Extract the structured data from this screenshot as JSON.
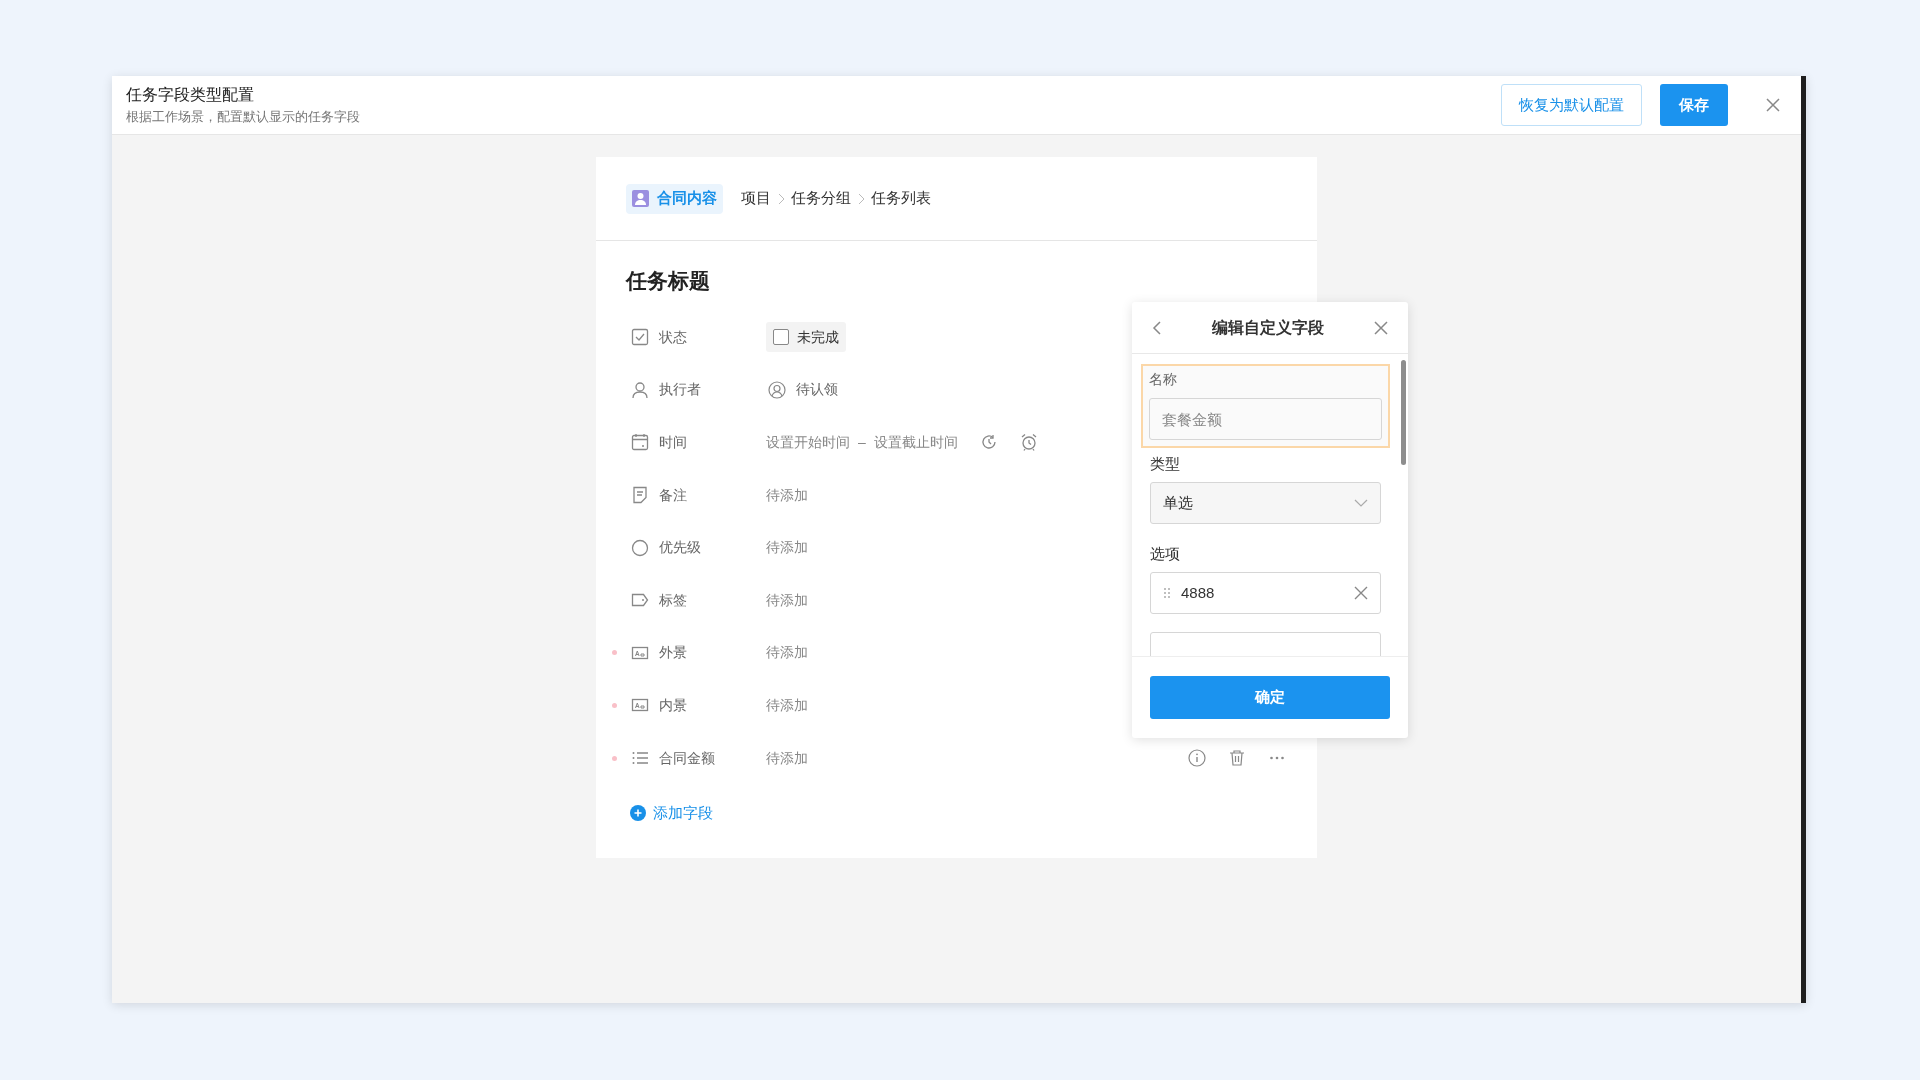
{
  "window": {
    "title": "任务字段类型配置",
    "subtitle": "根据工作场景，配置默认显示的任务字段",
    "buttons": [
      {
        "label": "恢复为默认配置",
        "kind": "outline"
      },
      {
        "label": "保存",
        "kind": "primary"
      }
    ]
  },
  "breadcrumb": {
    "badge": "合同内容",
    "items": [
      "项目",
      "任务分组",
      "任务列表"
    ]
  },
  "task": {
    "title": "任务标题",
    "fields": [
      {
        "label": "状态",
        "kind": "checkbox",
        "value": "未完成",
        "checked": false
      },
      {
        "label": "执行者",
        "kind": "user",
        "value": "待认领"
      },
      {
        "label": "时间",
        "kind": "range",
        "start": "设置开始时间",
        "separator": "–",
        "end": "设置截止时间"
      },
      {
        "label": "备注",
        "kind": "plain",
        "value": "待添加"
      },
      {
        "label": "优先级",
        "kind": "plain",
        "value": "待添加"
      },
      {
        "label": "标签",
        "kind": "plain",
        "value": "待添加"
      },
      {
        "label": "外景",
        "kind": "plain",
        "value": "待添加",
        "required": true
      },
      {
        "label": "内景",
        "kind": "plain",
        "value": "待添加",
        "required": true
      },
      {
        "label": "合同金额",
        "kind": "plain",
        "value": "待添加",
        "required": true,
        "hovered": true
      }
    ],
    "add_field": "添加字段"
  },
  "popup": {
    "title": "编辑自定义字段",
    "name": {
      "label": "名称",
      "placeholder": "套餐金额",
      "highlighted": true
    },
    "type": {
      "label": "类型",
      "value": "单选"
    },
    "options": {
      "label": "选项",
      "items": [
        {
          "value": "4888"
        }
      ]
    },
    "confirm": "确定"
  }
}
